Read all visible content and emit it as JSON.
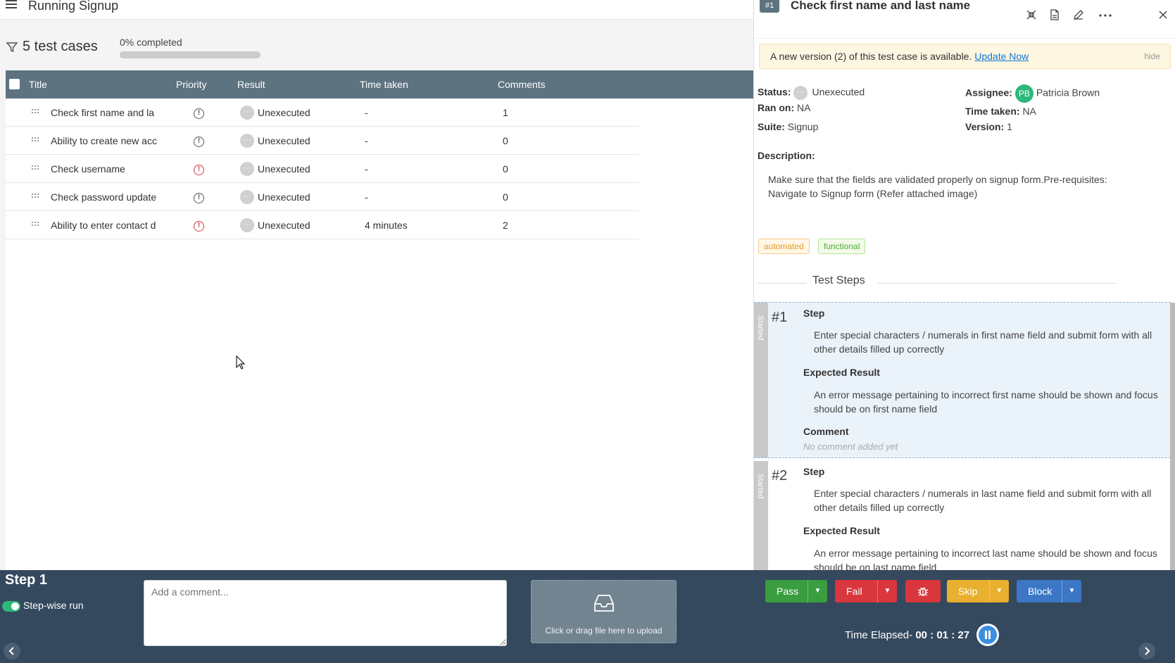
{
  "app": {
    "title": "Running Signup"
  },
  "summary": {
    "count_label": "5 test cases",
    "progress_label": "0% completed",
    "progress_fraction": 0
  },
  "table": {
    "headers": {
      "title": "Title",
      "priority": "Priority",
      "result": "Result",
      "time_taken": "Time taken",
      "comments": "Comments"
    },
    "rows": [
      {
        "title": "Check first name and la",
        "priority": "medium",
        "result": "Unexecuted",
        "time": "-",
        "comments": "1"
      },
      {
        "title": "Ability to create new acc",
        "priority": "medium",
        "result": "Unexecuted",
        "time": "-",
        "comments": "0"
      },
      {
        "title": "Check username",
        "priority": "high",
        "result": "Unexecuted",
        "time": "-",
        "comments": "0"
      },
      {
        "title": "Check password update",
        "priority": "medium",
        "result": "Unexecuted",
        "time": "-",
        "comments": "0"
      },
      {
        "title": "Ability to enter contact d",
        "priority": "high",
        "result": "Unexecuted",
        "time": "4 minutes",
        "comments": "2"
      }
    ]
  },
  "panel": {
    "badge": "#1",
    "title": "Check first name and last name",
    "banner": {
      "message": "A new version (2) of this test case is available.",
      "link": "Update Now",
      "hide": "hide"
    },
    "status_label": "Status:",
    "status": "Unexecuted",
    "ran_on_label": "Ran on:",
    "ran_on": "NA",
    "suite_label": "Suite:",
    "suite": "Signup",
    "assignee_label": "Assignee:",
    "assignee_initials": "PB",
    "assignee": "Patricia Brown",
    "time_taken_label": "Time taken:",
    "time_taken": "NA",
    "version_label": "Version:",
    "version": "1",
    "description_label": "Description:",
    "description": "Make sure that the fields are validated properly on signup form.Pre-requisites: Navigate to Signup form (Refer attached image)",
    "tags": [
      "automated",
      "functional"
    ],
    "steps_heading": "Test Steps",
    "steps": [
      {
        "num": "#1",
        "state": "Started",
        "step_label": "Step",
        "step": "Enter special characters / numerals in first name field and submit form with all other details filled up correctly",
        "expected_label": "Expected Result",
        "expected": "An error message pertaining to incorrect first name should be shown and focus should be on first name field",
        "comment_label": "Comment",
        "comment": "No comment added yet"
      },
      {
        "num": "#2",
        "state": "Started",
        "step_label": "Step",
        "step": "Enter special characters / numerals in last name field and submit form with all other details filled up correctly",
        "expected_label": "Expected Result",
        "expected": "An error message pertaining to incorrect last name should be shown and focus should be on last name field"
      }
    ]
  },
  "bottom": {
    "step_label": "Step 1",
    "toggle_label": "Step-wise run",
    "toggle_on": true,
    "comment_placeholder": "Add a comment...",
    "upload_label": "Click or drag file here to upload",
    "pass": "Pass",
    "fail": "Fail",
    "skip": "Skip",
    "block": "Block",
    "elapsed_label": "Time Elapsed-",
    "elapsed": "00 : 01 : 27"
  },
  "colors": {
    "header": "#5d7380",
    "bottombar": "#34495e",
    "pass": "#3a9d3f",
    "fail": "#d9363e",
    "skip": "#e8b02e",
    "block": "#3c77c6"
  },
  "icons": [
    "menu-icon",
    "filter-icon",
    "drag-handle-icon",
    "priority-icon",
    "minimize-icon",
    "document-icon",
    "edit-icon",
    "more-icon",
    "close-icon",
    "bug-icon",
    "inbox-icon",
    "pause-icon",
    "chevron-left-icon",
    "chevron-right-icon",
    "caret-down-icon"
  ]
}
